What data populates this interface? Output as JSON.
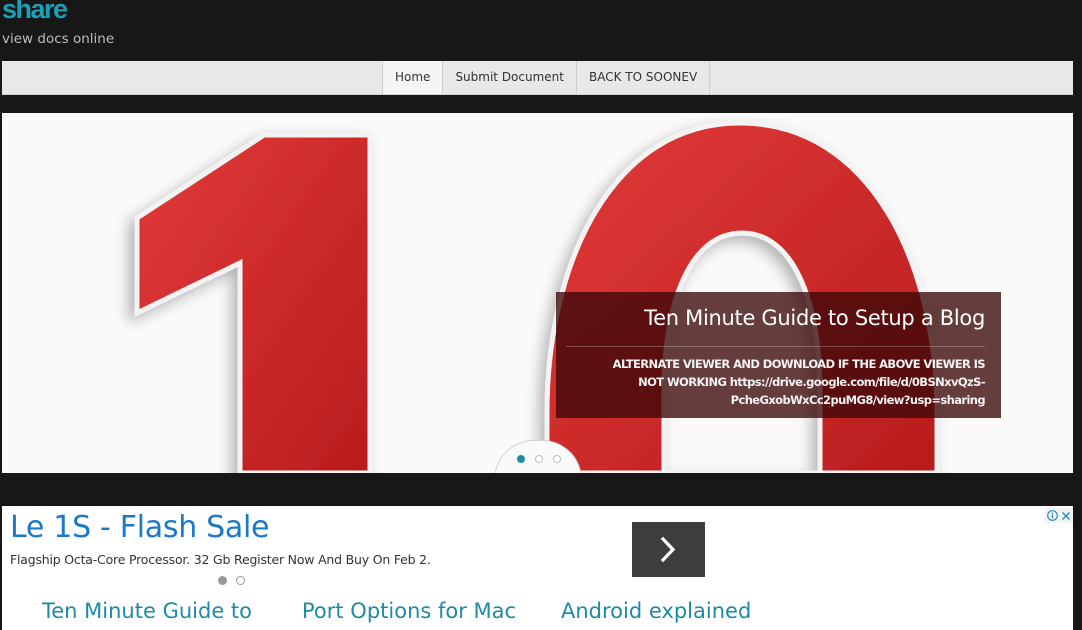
{
  "header": {
    "logo": "share",
    "tagline": "view docs online"
  },
  "nav": {
    "items": [
      {
        "label": "Home",
        "active": true
      },
      {
        "label": "Submit Document",
        "active": false
      },
      {
        "label": "BACK TO SOONEV",
        "active": false
      }
    ]
  },
  "slider": {
    "image_text": "10",
    "caption_title": "Ten Minute Guide to Setup a Blog",
    "caption_text": "ALTERNATE VIEWER AND DOWNLOAD IF THE ABOVE VIEWER IS NOT WORKING https://drive.google.com/file/d/0BSNxvQzS-PcheGxobWxCc2puMG8/view?usp=sharing",
    "dot_count": 3,
    "active_dot": 0
  },
  "ad": {
    "title": "Le 1S - Flash Sale",
    "description": "Flagship Octa-Core Processor. 32 Gb Register Now And Buy On Feb 2.",
    "dot_count": 2,
    "active_dot": 0
  },
  "related": [
    {
      "title": "Ten Minute Guide to"
    },
    {
      "title": "Port Options for Mac"
    },
    {
      "title": "Android explained"
    }
  ],
  "colors": {
    "brand": "#1aa1b8",
    "background": "#171717",
    "link": "#1e8aa6",
    "ad_title": "#1a79c8",
    "digit_red": "#d42a2a"
  }
}
